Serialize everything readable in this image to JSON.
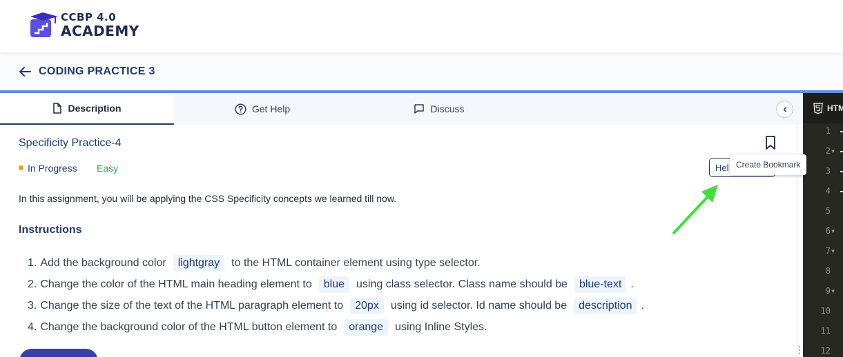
{
  "brand": {
    "logo_top": "CCBP 4.0",
    "logo_bottom": "ACADEMY",
    "primary_color": "#1e2a52",
    "accent_color": "#5f8fd6"
  },
  "breadcrumb": {
    "back_icon": "arrow-left-icon",
    "title": "CODING PRACTICE 3"
  },
  "tabs": [
    {
      "label": "Description",
      "icon": "document-icon",
      "active": true
    },
    {
      "label": "Get Help",
      "icon": "question-circle-icon",
      "active": false
    },
    {
      "label": "Discuss",
      "icon": "chat-icon",
      "active": false
    }
  ],
  "problem": {
    "title": "Specificity Practice-4",
    "status": "In Progress",
    "difficulty": "Easy",
    "help_button": "Help",
    "help_button_visible": "Hel",
    "tooltip": "Create Bookmark",
    "intro": "In this assignment, you will be applying the CSS Specificity concepts we learned till now.",
    "instructions_heading": "Instructions"
  },
  "steps": [
    {
      "num": "1.",
      "t1": "Add the background color",
      "c1": "lightgray",
      "t2": "to the HTML container element using type selector."
    },
    {
      "num": "2.",
      "t1": "Change the color of the HTML main heading element to",
      "c1": "blue",
      "t2": "using class selector. Class name should be",
      "c2": "blue-text",
      "t3": "."
    },
    {
      "num": "3.",
      "t1": "Change the size of the text of the HTML paragraph element to",
      "c1": "20px",
      "t2": "using id selector. Id name should be",
      "c2": "description",
      "t3": "."
    },
    {
      "num": "4.",
      "t1": "Change the background color of the HTML button element to",
      "c1": "orange",
      "t2": "using Inline Styles."
    }
  ],
  "editor": {
    "tab_label": "HTML",
    "line_numbers": [
      "1",
      "2",
      "3",
      "4",
      "5",
      "6",
      "7",
      "8",
      "9",
      "10",
      "11",
      "12"
    ]
  }
}
